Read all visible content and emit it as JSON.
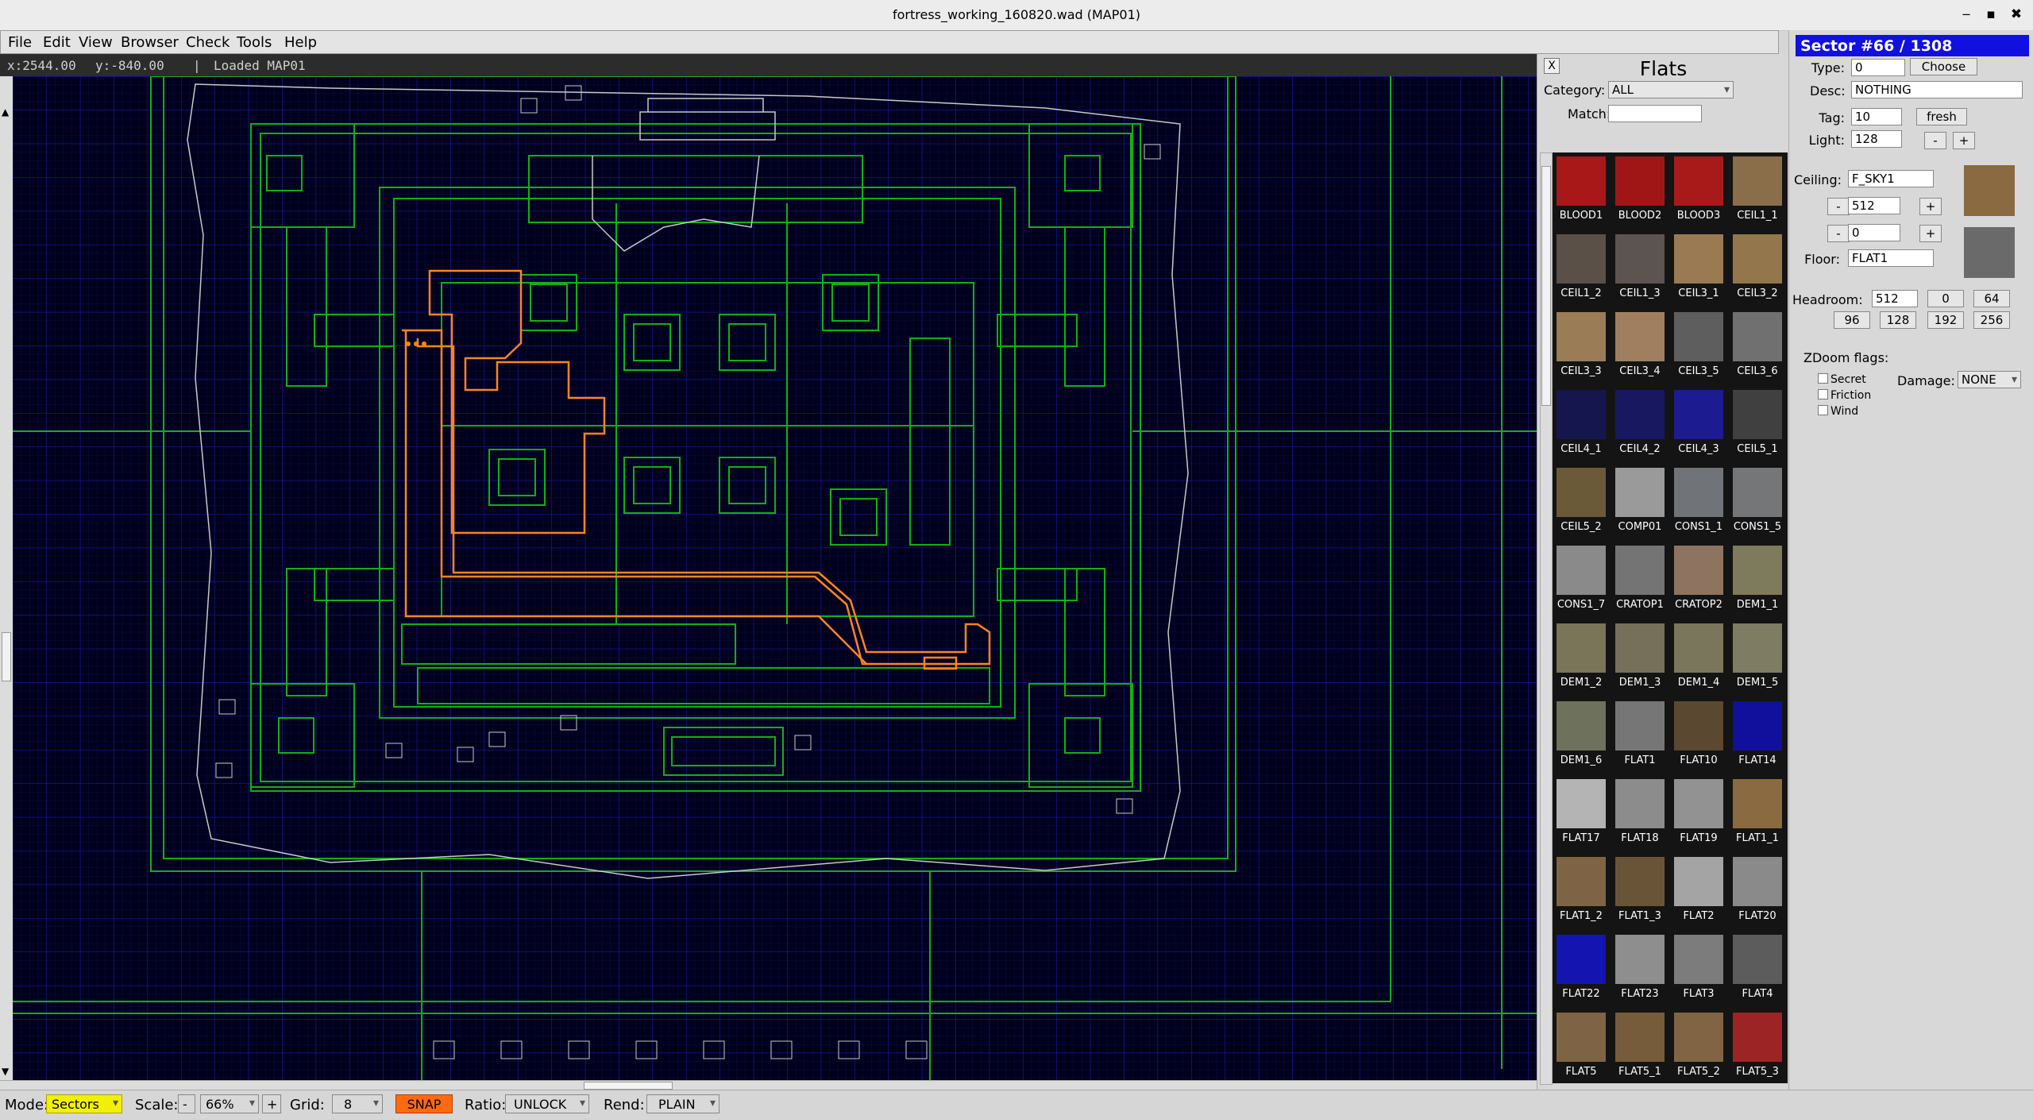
{
  "window": {
    "title": "fortress_working_160820.wad (MAP01)",
    "minimize": "‒",
    "maximize": "▪",
    "close": "✖"
  },
  "menu": [
    "File",
    "Edit",
    "View",
    "Browser",
    "Check",
    "Tools",
    "Help"
  ],
  "info": {
    "x": "x:2544.00",
    "y": "y:-840.00",
    "sep": "|",
    "status": "Loaded MAP01"
  },
  "status_bar": {
    "mode_label": "Mode:",
    "mode_value": "Sectors",
    "scale_label": "Scale:",
    "scale_minus": "-",
    "scale_value": "66%",
    "scale_plus": "+",
    "grid_label": "Grid:",
    "grid_value": "8",
    "snap": "SNAP",
    "ratio_label": "Ratio:",
    "ratio_value": "UNLOCK",
    "rend_label": "Rend:",
    "rend_value": "PLAIN"
  },
  "flats_panel": {
    "close": "X",
    "title": "Flats",
    "category_label": "Category:",
    "category_value": "ALL",
    "match_label": "Match:",
    "match_value": "",
    "items": [
      {
        "name": "BLOOD1",
        "color": "#a81818"
      },
      {
        "name": "BLOOD2",
        "color": "#a01616"
      },
      {
        "name": "BLOOD3",
        "color": "#a81a1a"
      },
      {
        "name": "CEIL1_1",
        "color": "#8a6e4a"
      },
      {
        "name": "CEIL1_2",
        "color": "#5a5048"
      },
      {
        "name": "CEIL1_3",
        "color": "#5c5450"
      },
      {
        "name": "CEIL3_1",
        "color": "#9a7a52"
      },
      {
        "name": "CEIL3_2",
        "color": "#94764c"
      },
      {
        "name": "CEIL3_3",
        "color": "#9a7c56"
      },
      {
        "name": "CEIL3_4",
        "color": "#a07e60"
      },
      {
        "name": "CEIL3_5",
        "color": "#5e5e5e"
      },
      {
        "name": "CEIL3_6",
        "color": "#707070"
      },
      {
        "name": "CEIL4_1",
        "color": "#16164e"
      },
      {
        "name": "CEIL4_2",
        "color": "#181860"
      },
      {
        "name": "CEIL4_3",
        "color": "#1c1c90"
      },
      {
        "name": "CEIL5_1",
        "color": "#404040"
      },
      {
        "name": "CEIL5_2",
        "color": "#6a5a38"
      },
      {
        "name": "COMP01",
        "color": "#9a9a9a"
      },
      {
        "name": "CONS1_1",
        "color": "#707478"
      },
      {
        "name": "CONS1_5",
        "color": "#747678"
      },
      {
        "name": "CONS1_7",
        "color": "#8a8a8a"
      },
      {
        "name": "CRATOP1",
        "color": "#747474"
      },
      {
        "name": "CRATOP2",
        "color": "#8e7460"
      },
      {
        "name": "DEM1_1",
        "color": "#7e7a5c"
      },
      {
        "name": "DEM1_2",
        "color": "#7a7458"
      },
      {
        "name": "DEM1_3",
        "color": "#76705a"
      },
      {
        "name": "DEM1_4",
        "color": "#7a765c"
      },
      {
        "name": "DEM1_5",
        "color": "#7e7c62"
      },
      {
        "name": "DEM1_6",
        "color": "#6e725c"
      },
      {
        "name": "FLAT1",
        "color": "#767676"
      },
      {
        "name": "FLAT10",
        "color": "#5a4830"
      },
      {
        "name": "FLAT14",
        "color": "#10109c"
      },
      {
        "name": "FLAT17",
        "color": "#b4b4b4"
      },
      {
        "name": "FLAT18",
        "color": "#8c8c8c"
      },
      {
        "name": "FLAT19",
        "color": "#929292"
      },
      {
        "name": "FLAT1_1",
        "color": "#8a6a40"
      },
      {
        "name": "FLAT1_2",
        "color": "#7e6444"
      },
      {
        "name": "FLAT1_3",
        "color": "#6a5438"
      },
      {
        "name": "FLAT2",
        "color": "#a4a4a4"
      },
      {
        "name": "FLAT20",
        "color": "#8a8a8a"
      },
      {
        "name": "FLAT22",
        "color": "#1414b0"
      },
      {
        "name": "FLAT23",
        "color": "#8e8e8e"
      },
      {
        "name": "FLAT3",
        "color": "#7c7c7c"
      },
      {
        "name": "FLAT4",
        "color": "#5c5c5c"
      },
      {
        "name": "FLAT5",
        "color": "#7e6444"
      },
      {
        "name": "FLAT5_1",
        "color": "#765c3a"
      },
      {
        "name": "FLAT5_2",
        "color": "#806444"
      },
      {
        "name": "FLAT5_3",
        "color": "#9c2424"
      }
    ]
  },
  "sector_panel": {
    "header": "Sector #66   / 1308",
    "type_label": "Type:",
    "type_value": "0",
    "choose": "Choose",
    "desc_label": "Desc:",
    "desc_value": "NOTHING",
    "tag_label": "Tag:",
    "tag_value": "10",
    "fresh": "fresh",
    "light_label": "Light:",
    "light_value": "128",
    "minus": "-",
    "plus": "+",
    "ceiling_label": "Ceiling:",
    "ceiling_tex": "F_SKY1",
    "ceiling_height": "512",
    "floor_height": "0",
    "floor_label": "Floor:",
    "floor_tex": "FLAT1",
    "headroom_label": "Headroom:",
    "headroom_value": "512",
    "headroom_presets": [
      "0",
      "64",
      "96",
      "128",
      "192",
      "256"
    ],
    "zdoom_label": "ZDoom flags:",
    "flags": [
      "Secret",
      "Friction",
      "Wind"
    ],
    "damage_label": "Damage:",
    "damage_value": "NONE",
    "ceiling_swatch_color": "#8a6a40",
    "floor_swatch_color": "#6a6a6a"
  },
  "map_colors": {
    "background": "#00001e",
    "grid_major": "#1c1cb4",
    "grid_minor": "#0c0c3c",
    "lines": "#12b012",
    "selected": "#ff8420",
    "white": "#c8c8c8"
  }
}
